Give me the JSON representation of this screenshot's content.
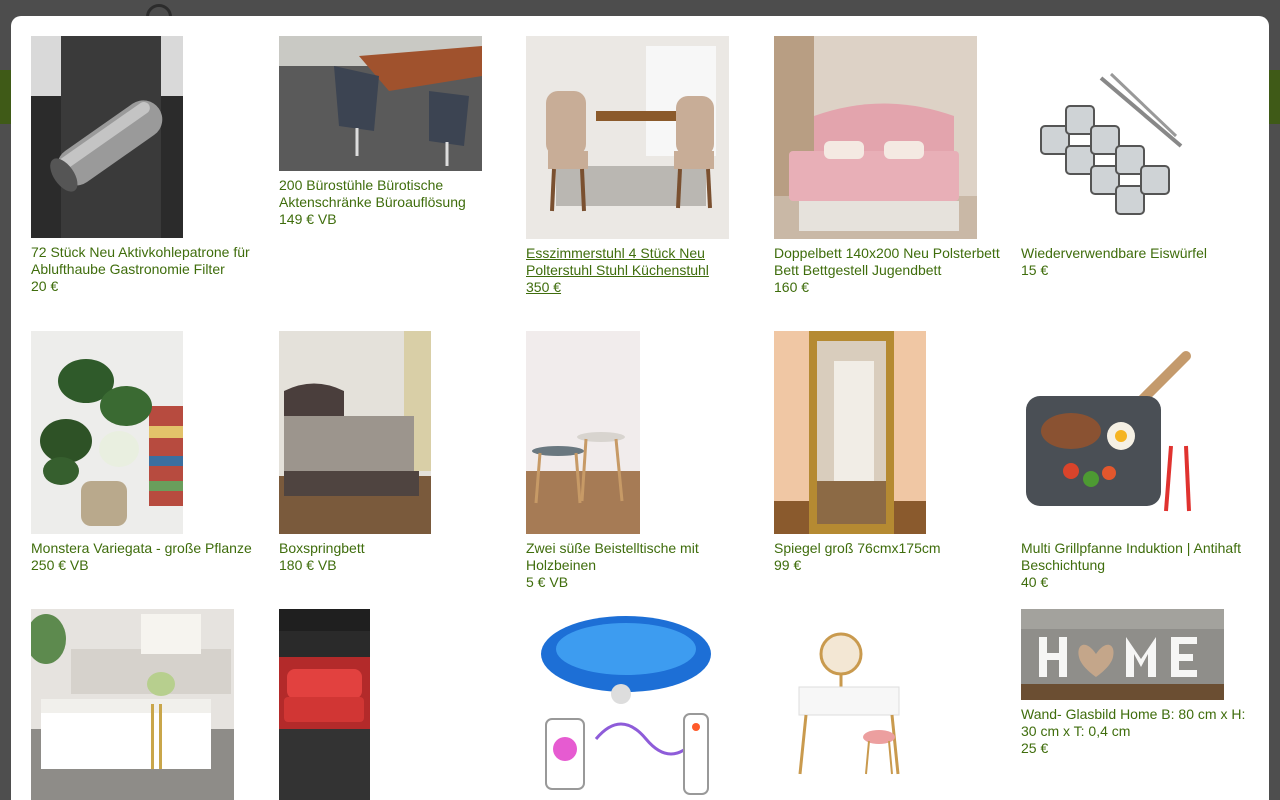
{
  "items": [
    {
      "title": "72 Stück Neu Aktivkohlepatrone für Ablufthaube Gastronomie Filter",
      "price": "20 €",
      "image": "carbon-filter-cartridge"
    },
    {
      "title": "200 Bürostühle Bürotische Aktenschränke Büroauflösung",
      "price": "149 € VB",
      "image": "office-chairs"
    },
    {
      "title": "Esszimmerstuhl 4 Stück Neu Polterstuhl Stuhl Küchenstuhl",
      "price": "350 €",
      "image": "dining-chairs"
    },
    {
      "title": "Doppelbett 140x200 Neu Polsterbett Bett Bettgestell Jugendbett",
      "price": "160 €",
      "image": "pink-double-bed"
    },
    {
      "title": "Wiederverwendbare Eiswürfel",
      "price": "15 €",
      "image": "steel-ice-cubes"
    },
    {
      "title": "Monstera Variegata - große Pflanze",
      "price": "250 € VB",
      "image": "monstera-plant"
    },
    {
      "title": "Boxspringbett",
      "price": "180 € VB",
      "image": "boxspring-bed"
    },
    {
      "title": "Zwei süße Beistelltische mit Holzbeinen",
      "price": "5 € VB",
      "image": "side-tables"
    },
    {
      "title": "Spiegel groß 76cmx175cm",
      "price": "99 €",
      "image": "gold-mirror"
    },
    {
      "title": "Multi Grillpfanne Induktion | Antihaft Beschichtung",
      "price": "40 €",
      "image": "grill-pan"
    },
    {
      "title": "",
      "price": "",
      "image": "tv-cabinet"
    },
    {
      "title": "",
      "price": "",
      "image": "red-sofa-phone-photo"
    },
    {
      "title": "",
      "price": "",
      "image": "led-ceiling-lamp"
    },
    {
      "title": "",
      "price": "",
      "image": "vanity-table"
    },
    {
      "title": "Wand- Glasbild Home B: 80 cm x H: 30 cm x T: 0,4 cm",
      "price": "25 €",
      "image": "home-glass-picture"
    }
  ]
}
